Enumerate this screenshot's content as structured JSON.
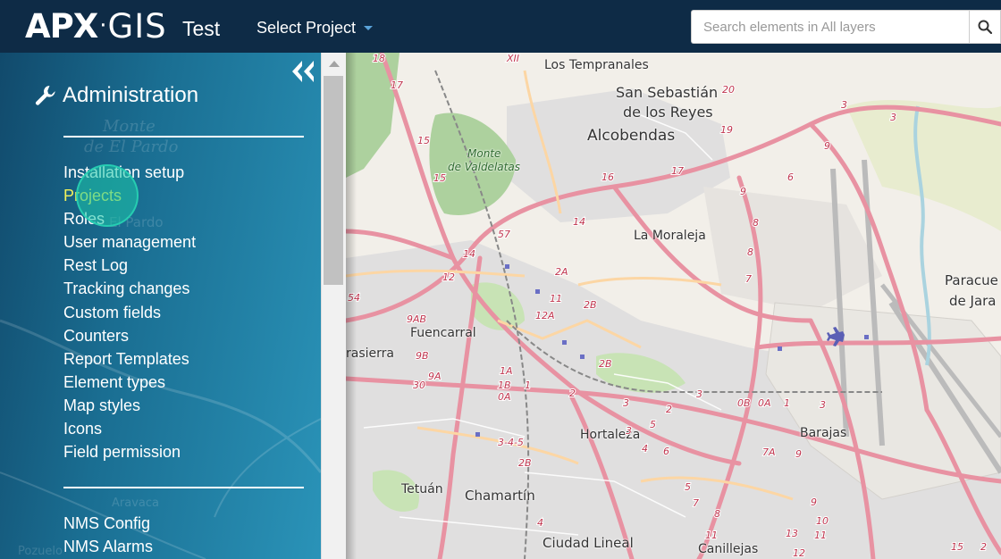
{
  "header": {
    "logo": {
      "apx": "APX",
      "sep": "·",
      "gis": "GIS"
    },
    "environment": "Test",
    "project_select": "Select Project",
    "search": {
      "placeholder": "Search elements in All layers"
    }
  },
  "sidebar": {
    "title": "Administration",
    "menu_primary": [
      "Installation setup",
      "Projects",
      "Roles",
      "User management",
      "Rest Log",
      "Tracking changes",
      "Custom fields",
      "Counters",
      "Report Templates",
      "Element types",
      "Map styles",
      "Icons",
      "Field permission"
    ],
    "active_item": "Projects",
    "menu_secondary": [
      "NMS Config",
      "NMS Alarms"
    ],
    "background_labels": [
      "Monte",
      "de El Pardo",
      "El Pardo",
      "Aravaca",
      "Pozuelo"
    ]
  },
  "map": {
    "places": [
      "Los Tempranales",
      "San Sebastián",
      "de los Reyes",
      "Alcobendas",
      "Monte",
      "de Valdelatas",
      "La Moraleja",
      "Paracue",
      "de Jara",
      "Fuencarral",
      "rasierra",
      "Hortaleza",
      "Barajas",
      "Tetuán",
      "Chamartín",
      "Ciudad Lineal",
      "Canillejas"
    ],
    "road_numbers": [
      "18",
      "XII",
      "17",
      "15",
      "15",
      "16",
      "17",
      "20",
      "19",
      "3",
      "3",
      "9",
      "6",
      "9",
      "8",
      "8",
      "7",
      "14",
      "57",
      "14",
      "12",
      "54",
      "9AB",
      "9B",
      "9A",
      "30",
      "1A",
      "1B",
      "0A",
      "1",
      "2",
      "3",
      "11",
      "12A",
      "2A",
      "2B",
      "2B",
      "3",
      "4",
      "5",
      "6",
      "2",
      "3-4-5",
      "2B",
      "4",
      "5",
      "7",
      "8",
      "9",
      "10",
      "11",
      "12",
      "13",
      "0B",
      "0A",
      "1",
      "7A",
      "9",
      "3",
      "15",
      "2",
      "3",
      "11"
    ]
  },
  "colors": {
    "header_bg": "#0e2b46",
    "sidebar_gradient_start": "#114a6c",
    "sidebar_gradient_end": "#2a93b8",
    "active_item": "#f2f25a",
    "map_bg": "#f2efe9",
    "road_motorway": "#e892a2",
    "road_trunk": "#f9b29c",
    "road_primary": "#fcd6a4",
    "park": "#add19e",
    "water": "#aad3df"
  },
  "icons": {
    "search": "search-icon",
    "collapse": "double-chevron-left-icon",
    "admin": "wrench-icon",
    "project_caret": "caret-down-icon"
  }
}
